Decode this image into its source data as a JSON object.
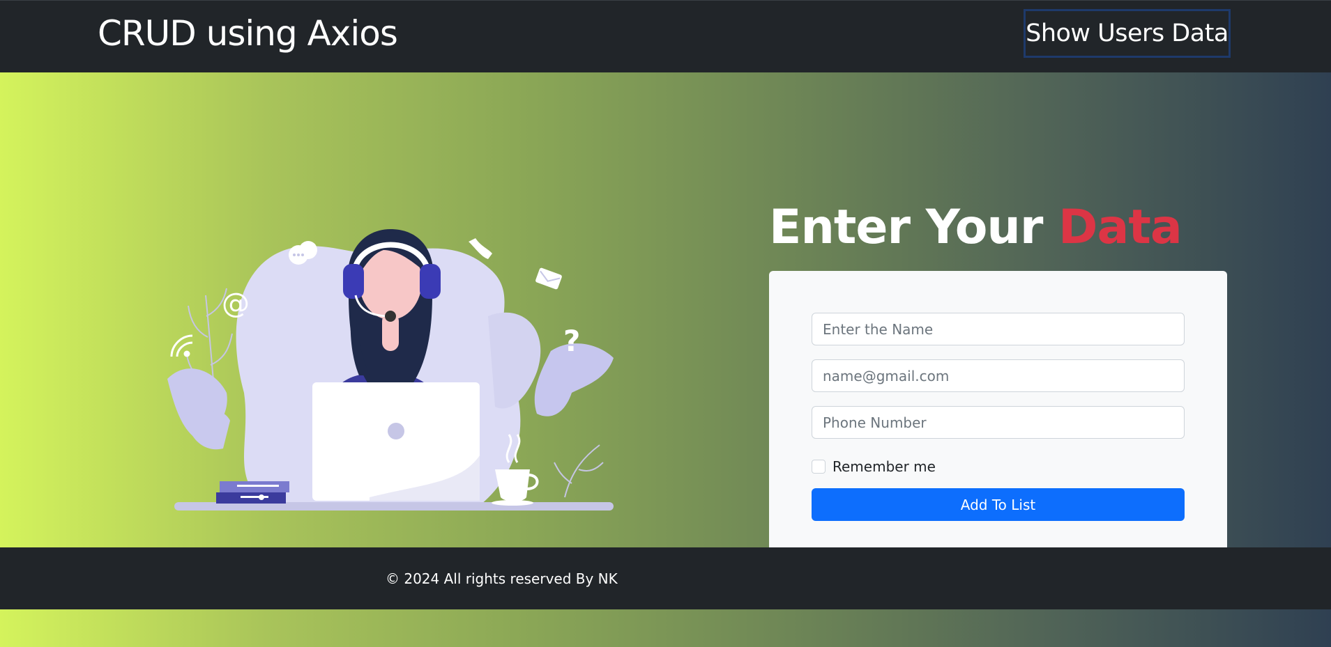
{
  "navbar": {
    "brand": "CRUD using Axios",
    "show_users_label": "Show Users Data"
  },
  "hero": {
    "heading_prefix": "Enter Your ",
    "heading_accent": "Data"
  },
  "form": {
    "name_placeholder": "Enter the Name",
    "email_placeholder": "name@gmail.com",
    "phone_placeholder": "Phone Number",
    "remember_label": "Remember me",
    "submit_label": "Add To List"
  },
  "footer": {
    "text": "© 2024 All rights reserved By NK"
  },
  "colors": {
    "accent": "#dc3545",
    "primary": "#0d6efd",
    "dark": "#212529"
  }
}
